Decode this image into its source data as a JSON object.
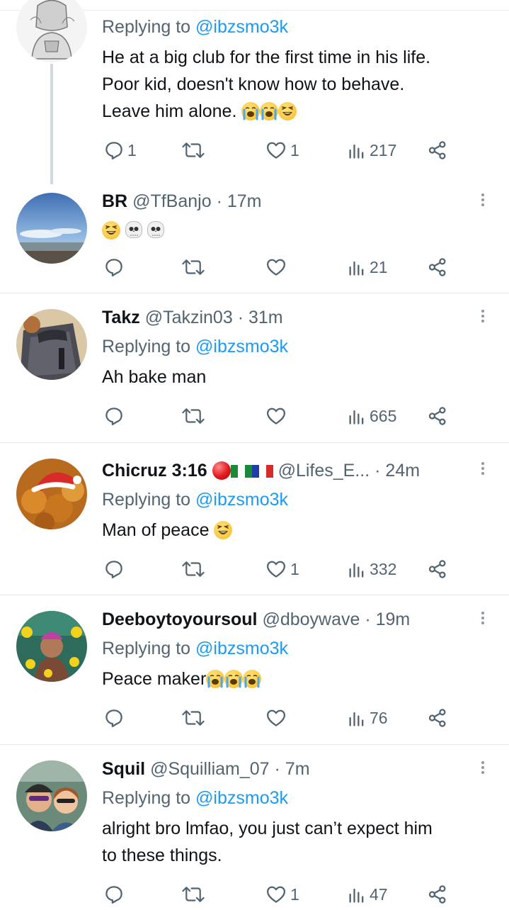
{
  "tweets": [
    {
      "replying_label": "Replying to",
      "replying_to": "@ibzsmo3k",
      "lines": [
        "He at a big club for the first time in his life.",
        "Poor kid, doesn't know how to behave.",
        "Leave him alone."
      ],
      "emojis": [
        "loudly-crying-face",
        "loudly-crying-face",
        "grinning-squinting-face"
      ],
      "replies": "1",
      "retweets": "",
      "likes": "1",
      "views": "217"
    },
    {
      "name": "BR",
      "handle": "@TfBanjo",
      "time": "17m",
      "emojis": [
        "grinning-squinting-face",
        "skull",
        "skull"
      ],
      "replies": "",
      "retweets": "",
      "likes": "",
      "views": "21"
    },
    {
      "name": "Takz",
      "handle": "@Takzin03",
      "time": "31m",
      "replying_label": "Replying to",
      "replying_to": "@ibzsmo3k",
      "text": "Ah bake man",
      "replies": "",
      "retweets": "",
      "likes": "",
      "views": "665"
    },
    {
      "name": "Chicruz 3:16",
      "name_emojis": [
        "red-ball",
        "flag-nigeria",
        "flag-france"
      ],
      "handle": "@Lifes_E...",
      "time": "24m",
      "replying_label": "Replying to",
      "replying_to": "@ibzsmo3k",
      "text": "Man of peace",
      "emojis": [
        "grinning-squinting-face"
      ],
      "replies": "",
      "retweets": "",
      "likes": "1",
      "views": "332"
    },
    {
      "name": "Deeboytoyoursoul",
      "handle": "@dboywave",
      "time": "19m",
      "replying_label": "Replying to",
      "replying_to": "@ibzsmo3k",
      "text": "Peace maker",
      "emojis": [
        "loudly-crying-face",
        "loudly-crying-face",
        "loudly-crying-face"
      ],
      "replies": "",
      "retweets": "",
      "likes": "",
      "views": "76"
    },
    {
      "name": "Squil",
      "handle": "@Squilliam_07",
      "time": "7m",
      "replying_label": "Replying to",
      "replying_to": "@ibzsmo3k",
      "lines": [
        "alright bro lmfao, you just can’t expect him",
        "to these things."
      ],
      "replies": "",
      "retweets": "",
      "likes": "1",
      "views": "47"
    }
  ],
  "separator": "·",
  "colors": {
    "accent": "#1d9bf0",
    "secondary_text": "#536471",
    "primary_text": "#0f1419",
    "divider": "#e3e8ec"
  },
  "icons": [
    "reply-icon",
    "retweet-icon",
    "like-icon",
    "views-icon",
    "share-icon",
    "more-icon"
  ]
}
